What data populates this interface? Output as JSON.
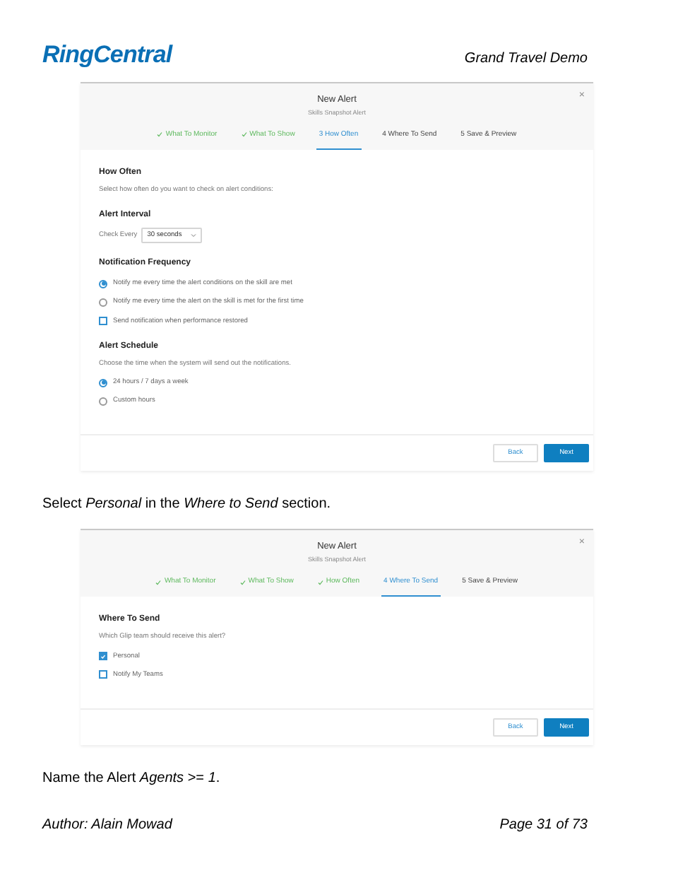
{
  "header": {
    "logo": "RingCentral",
    "document_title": "Grand Travel Demo"
  },
  "blocks": [
    {
      "kind": "dialog",
      "title": "New Alert",
      "subtitle": "Skills Snapshot Alert",
      "close": "×",
      "steps": [
        {
          "label": "What To Monitor",
          "done": true,
          "selected": false
        },
        {
          "label": "What To Show",
          "done": true,
          "selected": false
        },
        {
          "label": "3 How Often",
          "done": false,
          "selected": true
        },
        {
          "label": "4 Where To Send",
          "done": false,
          "selected": false
        },
        {
          "label": "5 Save & Preview",
          "done": false,
          "selected": false
        }
      ],
      "sections": [
        {
          "heading": "How Often",
          "description": "Select how often do you want to check on alert conditions:"
        },
        {
          "heading": "Alert Interval",
          "select": {
            "label": "Check Every",
            "value": "30 seconds"
          }
        },
        {
          "heading": "Notification Frequency",
          "options": [
            {
              "kind": "radio",
              "label": "Notify me every time the alert conditions on the skill are met",
              "checked": true
            },
            {
              "kind": "radio",
              "label": "Notify me every time the alert on the skill is met for the first time",
              "checked": false
            },
            {
              "kind": "checkbox",
              "label": "Send notification when performance restored",
              "checked": false
            }
          ]
        },
        {
          "heading": "Alert Schedule",
          "description": "Choose the time when the system will send out the notifications.",
          "options": [
            {
              "kind": "radio",
              "label": "24 hours / 7 days a week",
              "checked": true
            },
            {
              "kind": "radio",
              "label": "Custom hours",
              "checked": false
            }
          ]
        }
      ],
      "buttons": [
        {
          "label": "Back",
          "primary": false
        },
        {
          "label": "Next",
          "primary": true
        }
      ]
    },
    {
      "kind": "instruction",
      "text": "Select *Personal* in the *Where to Send* section."
    },
    {
      "kind": "dialog",
      "title": "New Alert",
      "subtitle": "Skills Snapshot Alert",
      "close": "×",
      "steps": [
        {
          "label": "What To Monitor",
          "done": true,
          "selected": false
        },
        {
          "label": "What To Show",
          "done": true,
          "selected": false
        },
        {
          "label": "How Often",
          "done": true,
          "selected": false
        },
        {
          "label": "4 Where To Send",
          "done": false,
          "selected": true
        },
        {
          "label": "5 Save & Preview",
          "done": false,
          "selected": false
        }
      ],
      "sections": [
        {
          "heading": "Where To Send",
          "description": "Which Glip team should receive this alert?",
          "options": [
            {
              "kind": "checkbox",
              "label": "Personal",
              "checked": true
            },
            {
              "kind": "checkbox",
              "label": "Notify My Teams",
              "checked": false
            }
          ]
        }
      ],
      "buttons": [
        {
          "label": "Back",
          "primary": false
        },
        {
          "label": "Next",
          "primary": true
        }
      ]
    },
    {
      "kind": "instruction",
      "text": "Name the Alert *Agents* >= *1*."
    }
  ],
  "footer": {
    "author": "Author: Alain Mowad",
    "page": "Page 31 of 73"
  }
}
